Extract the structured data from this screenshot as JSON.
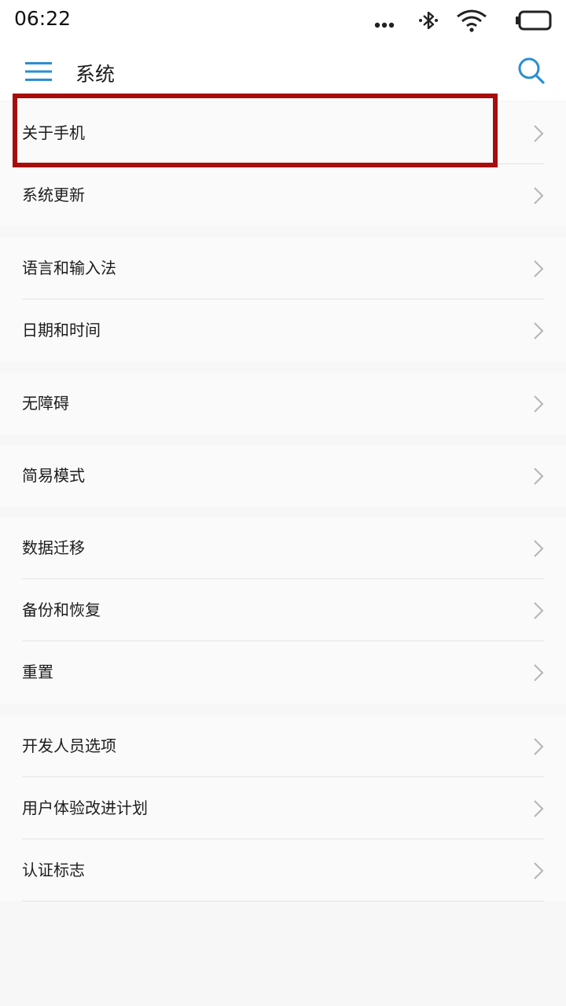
{
  "status_bar": {
    "time": "06:22",
    "icons": [
      "more-dots-icon",
      "bluetooth-icon",
      "wifi-icon",
      "battery-icon"
    ]
  },
  "header": {
    "title": "系统",
    "menu_icon": "hamburger-menu-icon",
    "search_icon": "search-icon",
    "accent_color": "#2a8fd0"
  },
  "groups": [
    {
      "items": [
        "关于手机",
        "系统更新"
      ]
    },
    {
      "items": [
        "语言和输入法",
        "日期和时间"
      ]
    },
    {
      "items": [
        "无障碍"
      ]
    },
    {
      "items": [
        "简易模式"
      ]
    },
    {
      "items": [
        "数据迁移",
        "备份和恢复",
        "重置"
      ]
    },
    {
      "items": [
        "开发人员选项",
        "用户体验改进计划",
        "认证标志"
      ]
    }
  ],
  "highlight": {
    "target": "关于手机",
    "color": "#a80d0d"
  }
}
